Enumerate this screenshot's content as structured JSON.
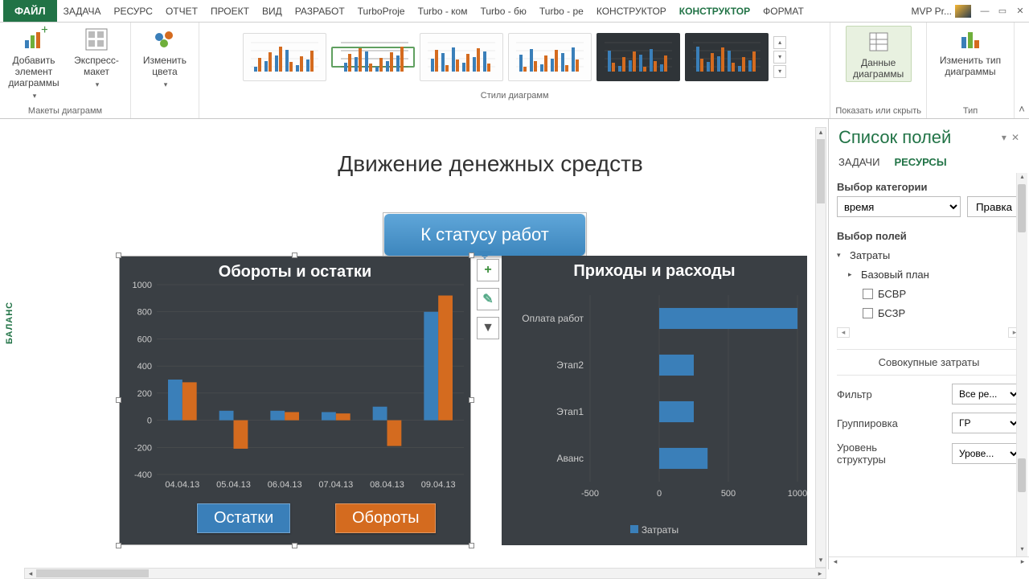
{
  "tabs": {
    "file": "ФАЙЛ",
    "items": [
      "ЗАДАЧА",
      "РЕСУРС",
      "ОТЧЕТ",
      "ПРОЕКТ",
      "ВИД",
      "РАЗРАБОТ",
      "TurboProje",
      "Turbo - ком",
      "Turbo - бю",
      "Turbo - ре",
      "КОНСТРУКТОР",
      "КОНСТРУКТОР",
      "ФОРМАТ"
    ],
    "active_index": 11,
    "doc_name": "MVP Pr..."
  },
  "ribbon": {
    "group1": {
      "btn1": "Добавить элемент\nдиаграммы",
      "btn2": "Экспресс-\nмакет",
      "label": "Макеты диаграмм"
    },
    "group2": {
      "btn": "Изменить\nцвета"
    },
    "group3": {
      "label": "Стили диаграмм"
    },
    "group4": {
      "btn": "Данные\nдиаграммы",
      "label": "Показать или скрыть"
    },
    "group5": {
      "btn": "Изменить тип\nдиаграммы",
      "label": "Тип"
    }
  },
  "sheet": {
    "vlabel": "БАЛАНС",
    "main_title": "Движение денежных средств",
    "callout": "К статусу работ"
  },
  "side": {
    "title": "Список полей",
    "tab_tasks": "ЗАДАЧИ",
    "tab_res": "РЕСУРСЫ",
    "cat_label": "Выбор категории",
    "cat_value": "время",
    "cat_btn": "Правка",
    "fields_label": "Выбор полей",
    "tree_root": "Затраты",
    "tree_base": "Базовый план",
    "tree_f1": "БСВР",
    "tree_f2": "БСЗР",
    "total": "Совокупные затраты",
    "filter_label": "Фильтр",
    "filter_value": "Все ре...",
    "group_label": "Группировка",
    "group_value": "ГР",
    "outline_label": "Уровень\nструктуры",
    "outline_value": "Урове..."
  },
  "chart_data": [
    {
      "type": "bar",
      "title": "Обороты и остатки",
      "categories": [
        "04.04.13",
        "05.04.13",
        "06.04.13",
        "07.04.13",
        "08.04.13",
        "09.04.13"
      ],
      "series": [
        {
          "name": "Остатки",
          "values": [
            300,
            70,
            70,
            60,
            100,
            800
          ],
          "color": "#3a7fb9"
        },
        {
          "name": "Обороты",
          "values": [
            280,
            -210,
            60,
            50,
            -190,
            920
          ],
          "color": "#d46b1f"
        }
      ],
      "ylim": [
        -400,
        1000
      ],
      "yticks": [
        -400,
        -200,
        0,
        200,
        400,
        600,
        800,
        1000
      ],
      "legend": [
        "Остатки",
        "Обороты"
      ]
    },
    {
      "type": "bar",
      "orientation": "horizontal",
      "title": "Приходы и расходы",
      "categories": [
        "Оплата работ",
        "Этап2",
        "Этап1",
        "Аванс"
      ],
      "series": [
        {
          "name": "Затраты",
          "values": [
            1000,
            250,
            250,
            350
          ],
          "color": "#3a7fb9"
        }
      ],
      "xlim": [
        -500,
        1000
      ],
      "xticks": [
        -500,
        0,
        500,
        1000
      ],
      "legend": [
        "Затраты"
      ]
    }
  ]
}
